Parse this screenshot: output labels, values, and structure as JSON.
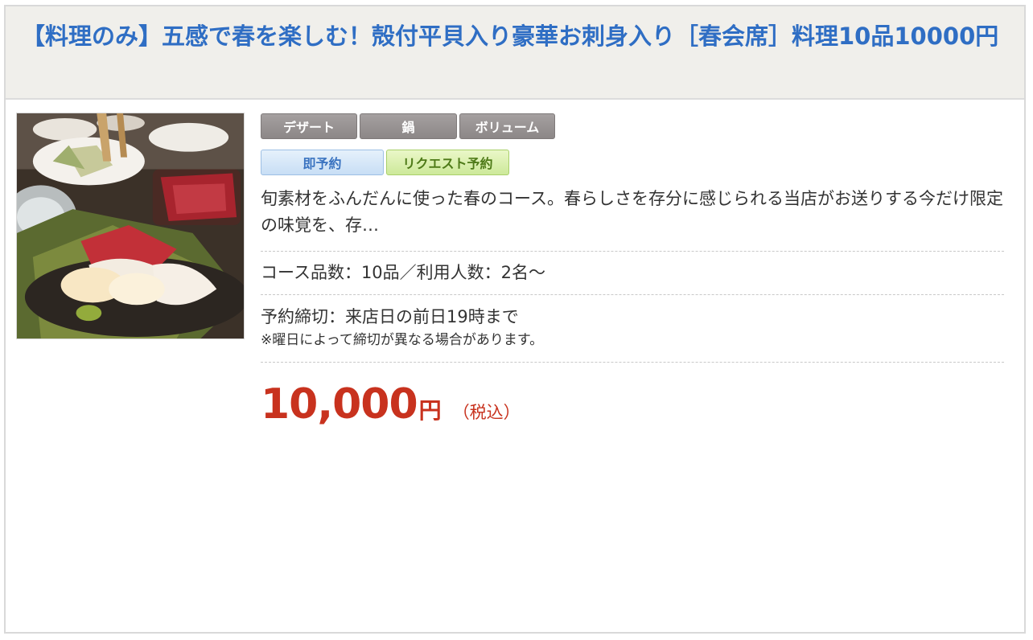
{
  "plan": {
    "title": "【料理のみ】五感で春を楽しむ！殻付平貝入り豪華お刺身入り［春会席］料理10品10000円",
    "category_tags": [
      "デザート",
      "鍋",
      "ボリューム"
    ],
    "booking_tags": [
      "即予約",
      "リクエスト予約"
    ],
    "description": "旬素材をふんだんに使った春のコース。春らしさを存分に感じられる当店がお送りする今だけ限定の味覚を、存…",
    "course_info": "コース品数：10品／利用人数：2名〜",
    "deadline": "予約締切：来店日の前日19時まで",
    "deadline_note": "※曜日によって締切が異なる場合があります。",
    "price": "10,000",
    "price_unit": "円",
    "tax_label": "（税込）"
  },
  "colors": {
    "title": "#2f6ec4",
    "price": "#c8321e",
    "title_bg": "#f0efeb"
  }
}
